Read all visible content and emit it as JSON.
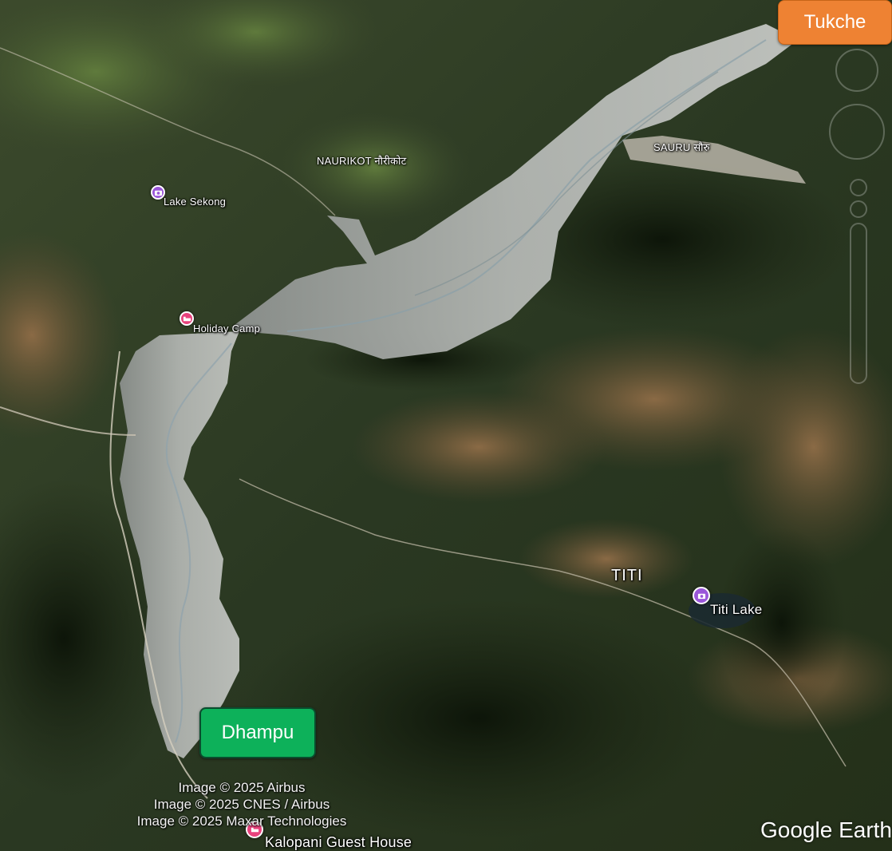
{
  "places": [
    {
      "id": "naurikot",
      "text": "NAURIKOT नौरीकोट"
    },
    {
      "id": "sauru",
      "text": "SAURU सौरु"
    },
    {
      "id": "titi",
      "text": "TITI"
    }
  ],
  "pois": [
    {
      "id": "lake-sekong",
      "text": "Lake Sekong",
      "icon": "camera-icon",
      "color": "#9a56d9"
    },
    {
      "id": "holiday-camp",
      "text": "Holiday Camp",
      "icon": "bed-icon",
      "color": "#e8427d"
    },
    {
      "id": "titi-lake",
      "text": "Titi Lake",
      "icon": "camera-icon",
      "color": "#9a56d9"
    },
    {
      "id": "kalopani",
      "text": "Kalopani Guest House",
      "icon": "bed-icon",
      "color": "#e8427d"
    }
  ],
  "tags": {
    "tukche": "Tukche",
    "dhampu": "Dhampu"
  },
  "attribution": [
    "Image © 2025 Airbus",
    "Image © 2025 CNES / Airbus",
    "Image © 2025 Maxar Technologies"
  ],
  "brand": "Google Earth",
  "controls": {
    "compass_icon": "compass-icon",
    "tilt_icon": "tilt-slider-icon"
  }
}
